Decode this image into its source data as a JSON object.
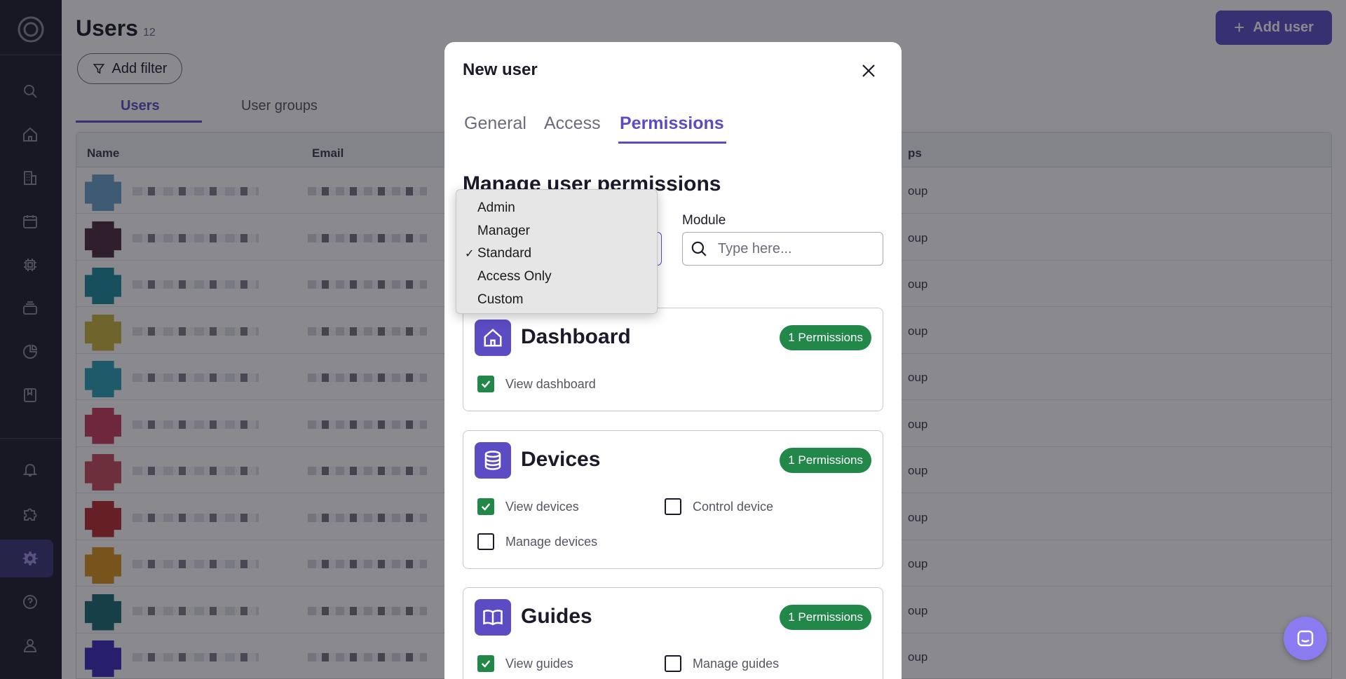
{
  "app": {
    "page_title": "Users",
    "user_count": "12",
    "add_user_label": "Add user",
    "add_filter_label": "Add filter",
    "tabs": [
      {
        "label": "Users"
      },
      {
        "label": "User groups"
      }
    ],
    "table": {
      "columns": {
        "name": "Name",
        "email": "Email",
        "groups": "ps"
      },
      "rows": [
        {
          "group": "oup",
          "avatar": "#6aa0c8"
        },
        {
          "group": "oup",
          "avatar": "#4a2a3a"
        },
        {
          "group": "oup",
          "avatar": "#1a8a9a"
        },
        {
          "group": "oup",
          "avatar": "#c8b43a"
        },
        {
          "group": "oup",
          "avatar": "#2aa0b8"
        },
        {
          "group": "oup",
          "avatar": "#c83a5a"
        },
        {
          "group": "oup",
          "avatar": "#c84a5a"
        },
        {
          "group": "oup",
          "avatar": "#b82a2a"
        },
        {
          "group": "oup",
          "avatar": "#d8941a"
        },
        {
          "group": "oup",
          "avatar": "#1a6a70"
        },
        {
          "group": "oup",
          "avatar": "#3a2ab8"
        }
      ]
    }
  },
  "modal": {
    "title": "New user",
    "tabs": [
      {
        "label": "General"
      },
      {
        "label": "Access"
      },
      {
        "label": "Permissions"
      }
    ],
    "section_title": "Manage user permissions",
    "module_label": "Module",
    "module_placeholder": "Type here...",
    "cards": [
      {
        "title": "Dashboard",
        "badge": "1 Permissions",
        "permissions": [
          {
            "label": "View dashboard",
            "checked": true
          }
        ]
      },
      {
        "title": "Devices",
        "badge": "1 Permissions",
        "permissions": [
          {
            "label": "View devices",
            "checked": true
          },
          {
            "label": "Control device",
            "checked": false
          },
          {
            "label": "Manage devices",
            "checked": false
          }
        ]
      },
      {
        "title": "Guides",
        "badge": "1 Permissions",
        "permissions": [
          {
            "label": "View guides",
            "checked": true
          },
          {
            "label": "Manage guides",
            "checked": false
          }
        ]
      }
    ]
  },
  "dropdown": {
    "selected": "Standard",
    "check_glyph": "✓",
    "options": [
      "Admin",
      "Manager",
      "Standard",
      "Access Only",
      "Custom"
    ]
  },
  "colors": {
    "accent": "#5b4cc4",
    "success": "#22884a",
    "sidebar_bg": "#1d1c2b"
  }
}
